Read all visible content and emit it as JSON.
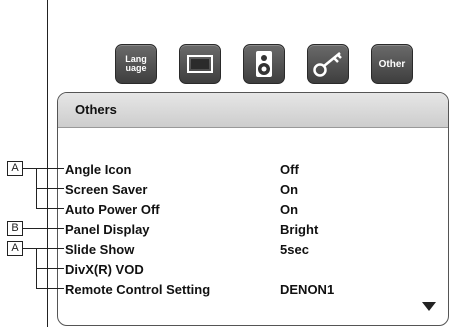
{
  "icon_bar": {
    "items": [
      {
        "label": "Lang\nuage",
        "icon": "language-icon"
      },
      {
        "label": "",
        "icon": "screen-icon"
      },
      {
        "label": "",
        "icon": "speaker-icon"
      },
      {
        "label": "",
        "icon": "key-icon"
      },
      {
        "label": "Other",
        "icon": "other-icon"
      }
    ]
  },
  "panel": {
    "title": "Others",
    "rows": [
      {
        "label": "Angle Icon",
        "value": "Off"
      },
      {
        "label": "Screen Saver",
        "value": "On"
      },
      {
        "label": "Auto Power Off",
        "value": "On"
      },
      {
        "label": "Panel Display",
        "value": "Bright"
      },
      {
        "label": "Slide Show",
        "value": "5sec"
      },
      {
        "label": "DivX(R) VOD",
        "value": ""
      },
      {
        "label": "Remote Control Setting",
        "value": "DENON1"
      }
    ],
    "scroll_indicator_icon": "down-triangle-icon"
  },
  "annotations": {
    "bracket_a_top": "A",
    "bracket_b": "B",
    "bracket_a_bottom": "A"
  }
}
